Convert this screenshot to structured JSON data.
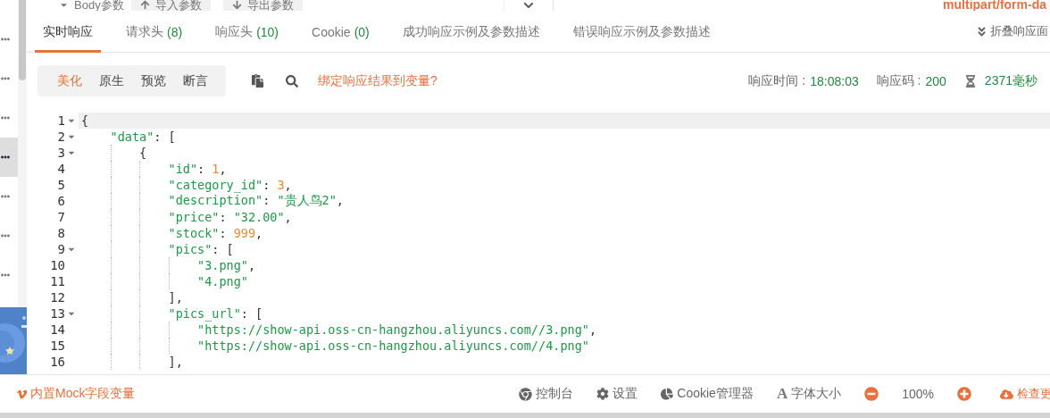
{
  "top_strip": {
    "body_params": "Body参数",
    "import_button": "导入参数",
    "export_button": "导出参数",
    "content_type": "multipart/form-da"
  },
  "sidebar": {
    "items": [
      {
        "selected": false
      },
      {
        "selected": false
      },
      {
        "selected": false
      },
      {
        "selected": true
      },
      {
        "selected": false
      },
      {
        "selected": false
      },
      {
        "selected": false
      }
    ]
  },
  "tabs": [
    {
      "label": "实时响应",
      "selected": true
    },
    {
      "label": "请求头",
      "count": "(8)",
      "selected": false
    },
    {
      "label": "响应头",
      "count": "(10)",
      "selected": false
    },
    {
      "label": "Cookie",
      "count": "(0)",
      "selected": false
    },
    {
      "label": "成功响应示例及参数描述",
      "selected": false
    },
    {
      "label": "错误响应示例及参数描述",
      "selected": false
    }
  ],
  "collapse_button": "折叠响应面",
  "view_modes": [
    {
      "label": "美化",
      "selected": true
    },
    {
      "label": "原生",
      "selected": false
    },
    {
      "label": "预览",
      "selected": false
    },
    {
      "label": "断言",
      "selected": false
    }
  ],
  "bind_link": "绑定响应结果到变量?",
  "stats": {
    "time_label": "响应时间 :",
    "time": "18:08:03",
    "code_label": "响应码 :",
    "code": "200",
    "duration": "2371毫秒"
  },
  "code_lines": [
    {
      "number": "1",
      "selected": true,
      "tokens": [
        {
          "kind": "punct",
          "text": "{"
        }
      ],
      "children": [
        {
          "number": "2",
          "selected": false,
          "tokens": [
            {
              "kind": "key",
              "text": "\"data\""
            },
            {
              "kind": "punct",
              "text": ": ["
            }
          ],
          "children": [
            {
              "number": "3",
              "selected": false,
              "tokens": [
                {
                  "kind": "punct",
                  "text": "{"
                }
              ],
              "children": [
                {
                  "number": "4",
                  "selected": false,
                  "tokens": [
                    {
                      "kind": "key",
                      "text": "\"id\""
                    },
                    {
                      "kind": "punct",
                      "text": ": "
                    },
                    {
                      "kind": "number",
                      "text": "1"
                    },
                    {
                      "kind": "punct",
                      "text": ","
                    }
                  ]
                },
                {
                  "number": "5",
                  "selected": false,
                  "tokens": [
                    {
                      "kind": "key",
                      "text": "\"category_id\""
                    },
                    {
                      "kind": "punct",
                      "text": ": "
                    },
                    {
                      "kind": "number",
                      "text": "3"
                    },
                    {
                      "kind": "punct",
                      "text": ","
                    }
                  ]
                },
                {
                  "number": "6",
                  "selected": false,
                  "tokens": [
                    {
                      "kind": "key",
                      "text": "\"description\""
                    },
                    {
                      "kind": "punct",
                      "text": ": "
                    },
                    {
                      "kind": "string",
                      "text": "\"贵人鸟2\""
                    },
                    {
                      "kind": "punct",
                      "text": ","
                    }
                  ]
                },
                {
                  "number": "7",
                  "selected": false,
                  "tokens": [
                    {
                      "kind": "key",
                      "text": "\"price\""
                    },
                    {
                      "kind": "punct",
                      "text": ": "
                    },
                    {
                      "kind": "string",
                      "text": "\"32.00\""
                    },
                    {
                      "kind": "punct",
                      "text": ","
                    }
                  ]
                },
                {
                  "number": "8",
                  "selected": false,
                  "tokens": [
                    {
                      "kind": "key",
                      "text": "\"stock\""
                    },
                    {
                      "kind": "punct",
                      "text": ": "
                    },
                    {
                      "kind": "number",
                      "text": "999"
                    },
                    {
                      "kind": "punct",
                      "text": ","
                    }
                  ]
                },
                {
                  "number": "9",
                  "selected": false,
                  "tokens": [
                    {
                      "kind": "key",
                      "text": "\"pics\""
                    },
                    {
                      "kind": "punct",
                      "text": ": ["
                    }
                  ],
                  "children": [
                    {
                      "number": "10",
                      "selected": false,
                      "tokens": [
                        {
                          "kind": "string",
                          "text": "\"3.png\""
                        },
                        {
                          "kind": "punct",
                          "text": ","
                        }
                      ]
                    },
                    {
                      "number": "11",
                      "selected": false,
                      "tokens": [
                        {
                          "kind": "string",
                          "text": "\"4.png\""
                        }
                      ]
                    }
                  ]
                },
                {
                  "number": "12",
                  "selected": false,
                  "tokens": [
                    {
                      "kind": "punct",
                      "text": "],"
                    }
                  ]
                },
                {
                  "number": "13",
                  "selected": false,
                  "tokens": [
                    {
                      "kind": "key",
                      "text": "\"pics_url\""
                    },
                    {
                      "kind": "punct",
                      "text": ": ["
                    }
                  ],
                  "children": [
                    {
                      "number": "14",
                      "selected": false,
                      "tokens": [
                        {
                          "kind": "string",
                          "text": "\"https://show-api.oss-cn-hangzhou.aliyuncs.com//3.png\""
                        },
                        {
                          "kind": "punct",
                          "text": ","
                        }
                      ]
                    },
                    {
                      "number": "15",
                      "selected": false,
                      "tokens": [
                        {
                          "kind": "string",
                          "text": "\"https://show-api.oss-cn-hangzhou.aliyuncs.com//4.png\""
                        }
                      ]
                    }
                  ]
                },
                {
                  "number": "16",
                  "selected": false,
                  "tokens": [
                    {
                      "kind": "punct",
                      "text": "],"
                    }
                  ]
                }
              ]
            }
          ]
        }
      ]
    }
  ],
  "status_bar": {
    "mock_link": "内置Mock字段变量",
    "items": [
      {
        "kind": "console",
        "label": "控制台"
      },
      {
        "kind": "settings",
        "label": "设置"
      },
      {
        "kind": "cookie",
        "label": "Cookie管理器"
      },
      {
        "kind": "font",
        "glyph": "A",
        "label": "字体大小"
      }
    ],
    "zoom": "100%",
    "update_link": "检查更"
  }
}
